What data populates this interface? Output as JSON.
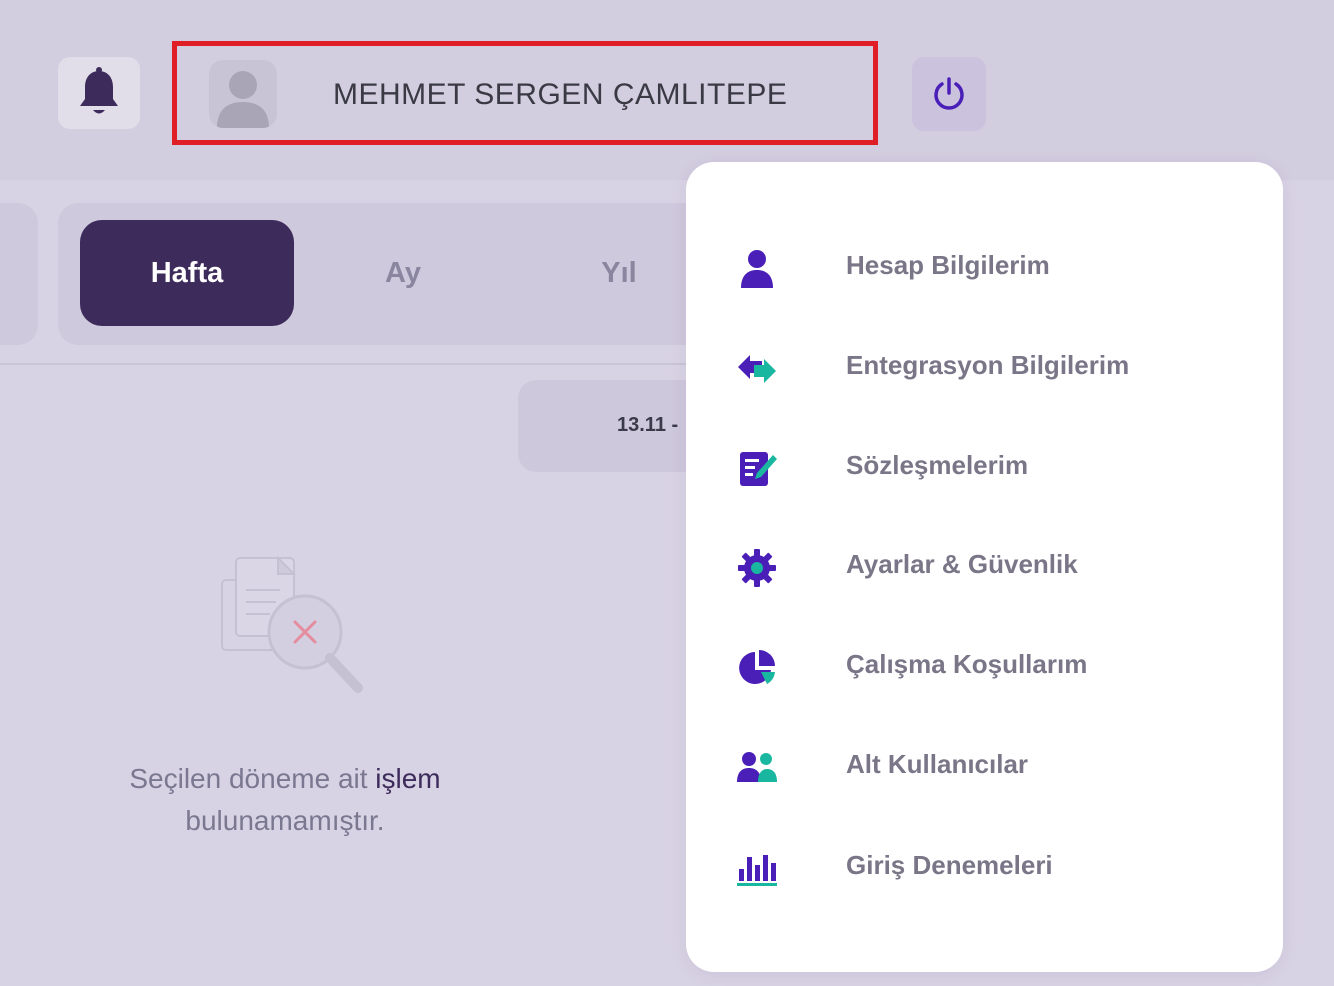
{
  "header": {
    "notification_icon": "bell-icon",
    "user_name": "MEHMET SERGEN ÇAMLITEPE",
    "avatar_icon": "user-avatar-icon",
    "logout_icon": "power-icon"
  },
  "period_tabs": [
    {
      "label": "Hafta",
      "active": true
    },
    {
      "label": "Ay",
      "active": false
    },
    {
      "label": "Yıl",
      "active": false
    }
  ],
  "date_range": "13.11 -",
  "empty_state": {
    "icon": "document-search-x-icon",
    "message_part1": "Seçilen döneme ait ",
    "message_highlight": "işlem",
    "message_part2": "bulunamamıştır."
  },
  "user_menu": {
    "items": [
      {
        "label": "Hesap Bilgilerim",
        "icon": "user-icon"
      },
      {
        "label": "Entegrasyon Bilgilerim",
        "icon": "exchange-icon"
      },
      {
        "label": "Sözleşmelerim",
        "icon": "contract-edit-icon"
      },
      {
        "label": "Ayarlar & Güvenlik",
        "icon": "gear-icon"
      },
      {
        "label": "Çalışma Koşullarım",
        "icon": "pie-chart-icon"
      },
      {
        "label": "Alt Kullanıcılar",
        "icon": "users-icon"
      },
      {
        "label": "Giriş Denemeleri",
        "icon": "bar-chart-icon"
      }
    ]
  },
  "colors": {
    "background": "#d8d3e4",
    "primary_dark": "#3d2b5b",
    "icon_purple": "#4a1fb8",
    "icon_teal": "#19b6a0",
    "highlight_border": "#e01e25"
  }
}
